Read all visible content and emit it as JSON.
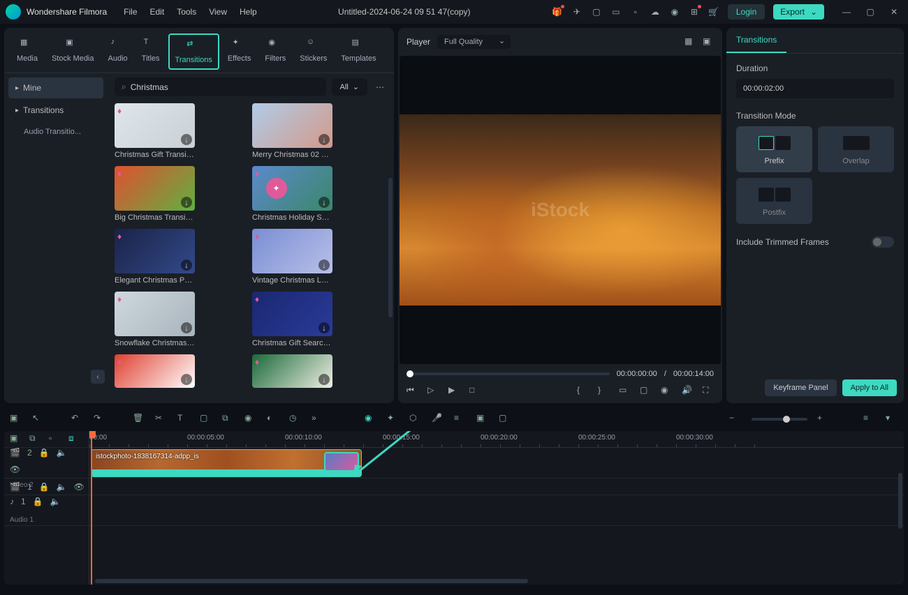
{
  "app": {
    "name": "Wondershare Filmora",
    "title": "Untitled-2024-06-24 09 51 47(copy)"
  },
  "menu": [
    "File",
    "Edit",
    "Tools",
    "View",
    "Help"
  ],
  "header": {
    "login": "Login",
    "export": "Export"
  },
  "tool_tabs": [
    {
      "label": "Media"
    },
    {
      "label": "Stock Media"
    },
    {
      "label": "Audio"
    },
    {
      "label": "Titles"
    },
    {
      "label": "Transitions",
      "active": true
    },
    {
      "label": "Effects"
    },
    {
      "label": "Filters"
    },
    {
      "label": "Stickers"
    },
    {
      "label": "Templates"
    }
  ],
  "sidebar": {
    "mine": "Mine",
    "transitions": "Transitions",
    "audio_trans": "Audio Transitio..."
  },
  "search": {
    "value": "Christmas",
    "all": "All"
  },
  "cards": [
    {
      "label": "Christmas Gift Transiti...",
      "gem": true,
      "colors": [
        "#dfe6ea",
        "#c8d0d6"
      ]
    },
    {
      "label": "Merry Christmas 02 Tr...",
      "gem": false,
      "colors": [
        "#b0cbe8",
        "#d49a8a"
      ]
    },
    {
      "label": "Big Christmas Transiti...",
      "gem": true,
      "colors": [
        "#e05030",
        "#60b040"
      ]
    },
    {
      "label": "Christmas Holiday Sal...",
      "gem": true,
      "colors": [
        "#5c89cc",
        "#3a886a"
      ],
      "icon": true
    },
    {
      "label": "Elegant Christmas Pac...",
      "gem": true,
      "colors": [
        "#1a2248",
        "#334a8a"
      ]
    },
    {
      "label": "Vintage Christmas Lett...",
      "gem": true,
      "colors": [
        "#7a8ed4",
        "#b8c0e8"
      ]
    },
    {
      "label": "Snowflake Christmas T...",
      "gem": true,
      "colors": [
        "#cfd8de",
        "#a8b4bc"
      ]
    },
    {
      "label": "Christmas Gift Search ...",
      "gem": true,
      "colors": [
        "#1a2870",
        "#2a3a9a"
      ]
    },
    {
      "label": "",
      "gem": true,
      "colors": [
        "#e04030",
        "#ffffff"
      ],
      "partial": true
    },
    {
      "label": "",
      "gem": true,
      "colors": [
        "#1a6a3a",
        "#f0eee4"
      ],
      "partial": true
    }
  ],
  "player": {
    "label": "Player",
    "quality": "Full Quality",
    "time_cur": "00:00:00:00",
    "time_sep": "/",
    "time_dur": "00:00:14:00",
    "watermark": "iStock"
  },
  "right": {
    "tab": "Transitions",
    "duration_label": "Duration",
    "duration_value": "00:00:02:00",
    "mode_label": "Transition Mode",
    "modes": {
      "prefix": "Prefix",
      "overlap": "Overlap",
      "postfix": "Postfix"
    },
    "trim_label": "Include Trimmed Frames",
    "keyframe": "Keyframe Panel",
    "apply": "Apply to All"
  },
  "timeline": {
    "ruler": [
      "00:00",
      "00:00:05:00",
      "00:00:10:00",
      "00:00:15:00",
      "00:00:20:00",
      "00:00:25:00",
      "00:00:30:00"
    ],
    "tracks": {
      "v2_num": "2",
      "v2_label": "Video 2",
      "v1_num": "1",
      "a1_num": "1",
      "a1_label": "Audio 1"
    },
    "clip_label": "istockphoto-1838167314-adpp_is"
  }
}
